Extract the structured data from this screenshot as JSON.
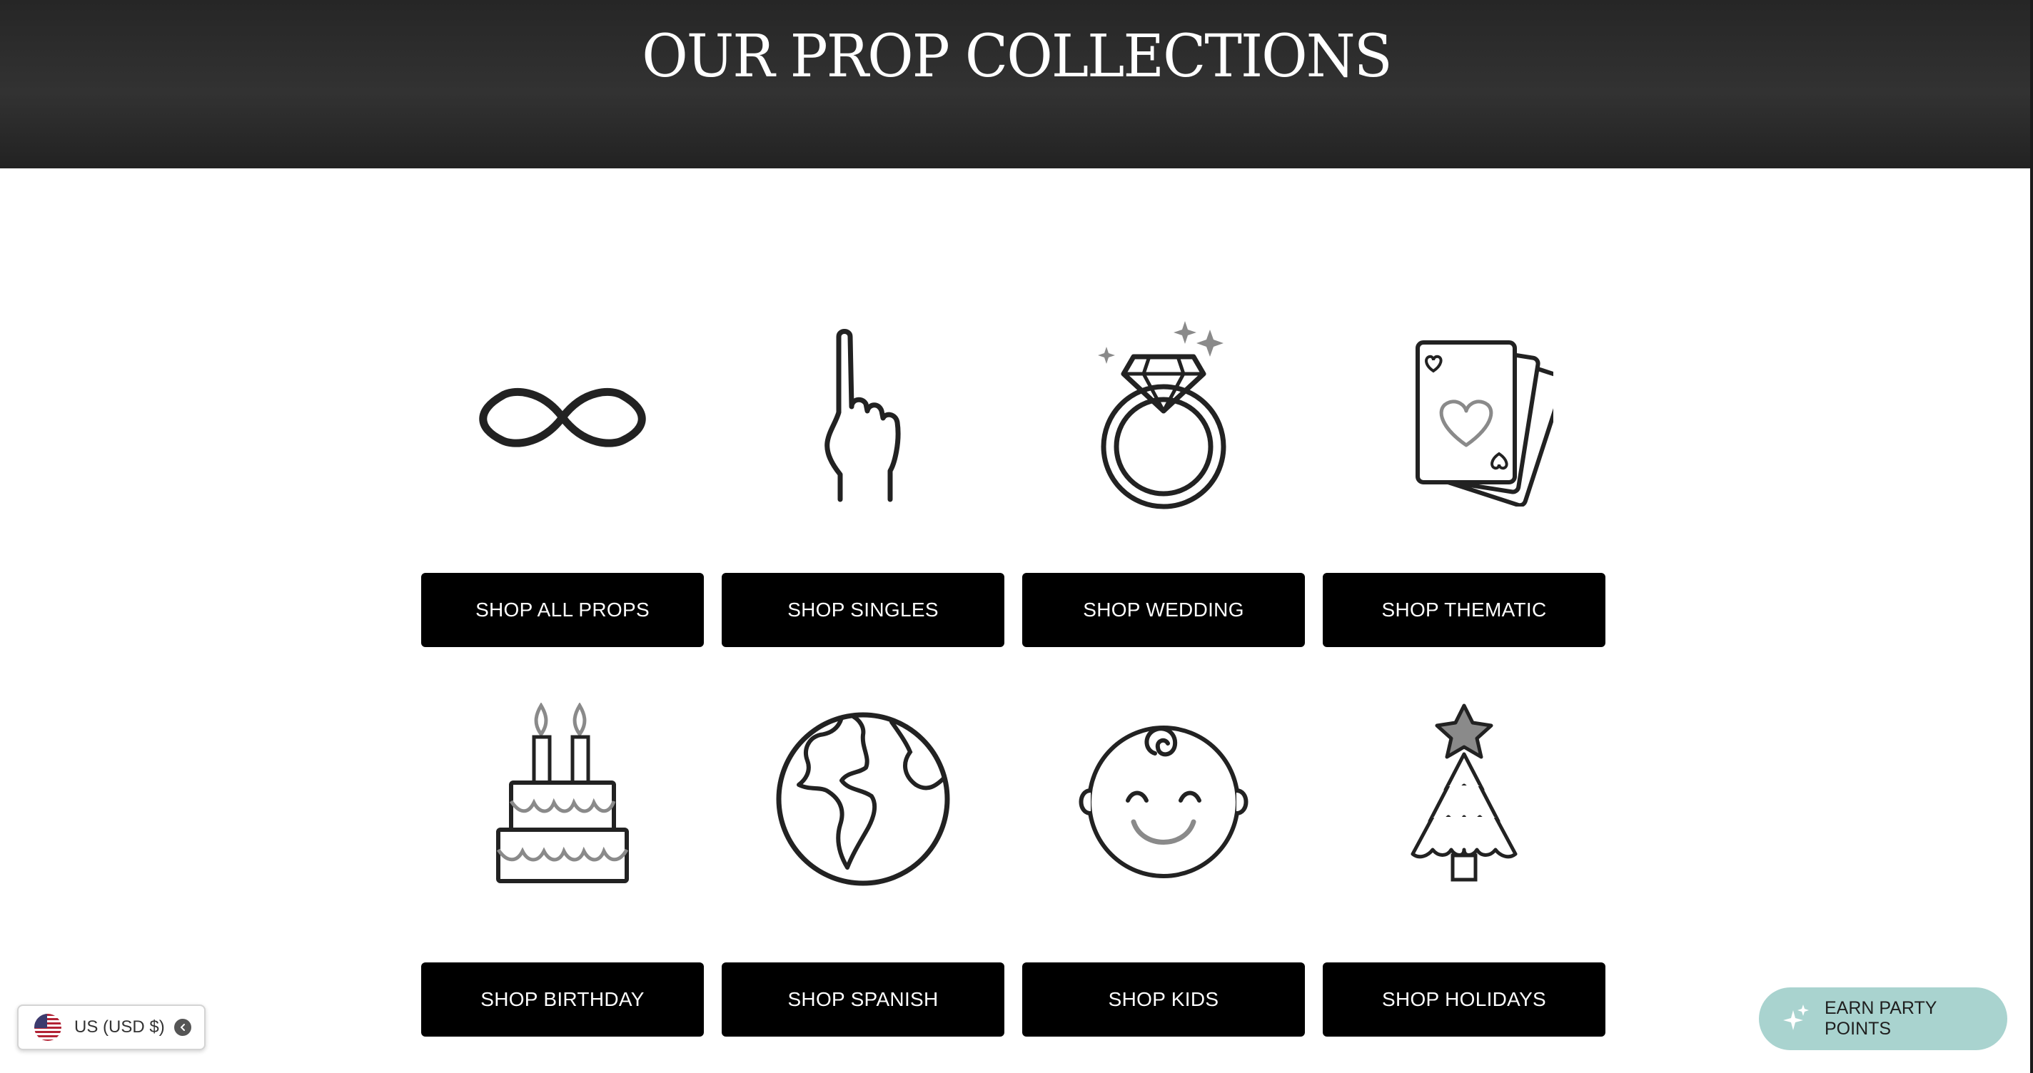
{
  "hero": {
    "title": "OUR PROP COLLECTIONS"
  },
  "collections": [
    {
      "label": "SHOP ALL PROPS",
      "icon": "infinity-icon"
    },
    {
      "label": "SHOP SINGLES",
      "icon": "pointing-hand-icon"
    },
    {
      "label": "SHOP WEDDING",
      "icon": "diamond-ring-icon"
    },
    {
      "label": "SHOP THEMATIC",
      "icon": "playing-cards-icon"
    },
    {
      "label": "SHOP BIRTHDAY",
      "icon": "birthday-cake-icon"
    },
    {
      "label": "SHOP SPANISH",
      "icon": "globe-icon"
    },
    {
      "label": "SHOP KIDS",
      "icon": "baby-face-icon"
    },
    {
      "label": "SHOP HOLIDAYS",
      "icon": "christmas-tree-icon"
    }
  ],
  "currency_selector": {
    "label": "US (USD $)",
    "icon": "us-flag-icon"
  },
  "rewards_launcher": {
    "label": "EARN PARTY POINTS",
    "icon": "sparkle-icon"
  },
  "colors": {
    "hero_bg": "#2e2e2e",
    "button_bg": "#000000",
    "button_text": "#ffffff",
    "icon_stroke": "#222222",
    "icon_accent": "#8a8a8a",
    "rewards_bg": "#a9d3cf"
  }
}
